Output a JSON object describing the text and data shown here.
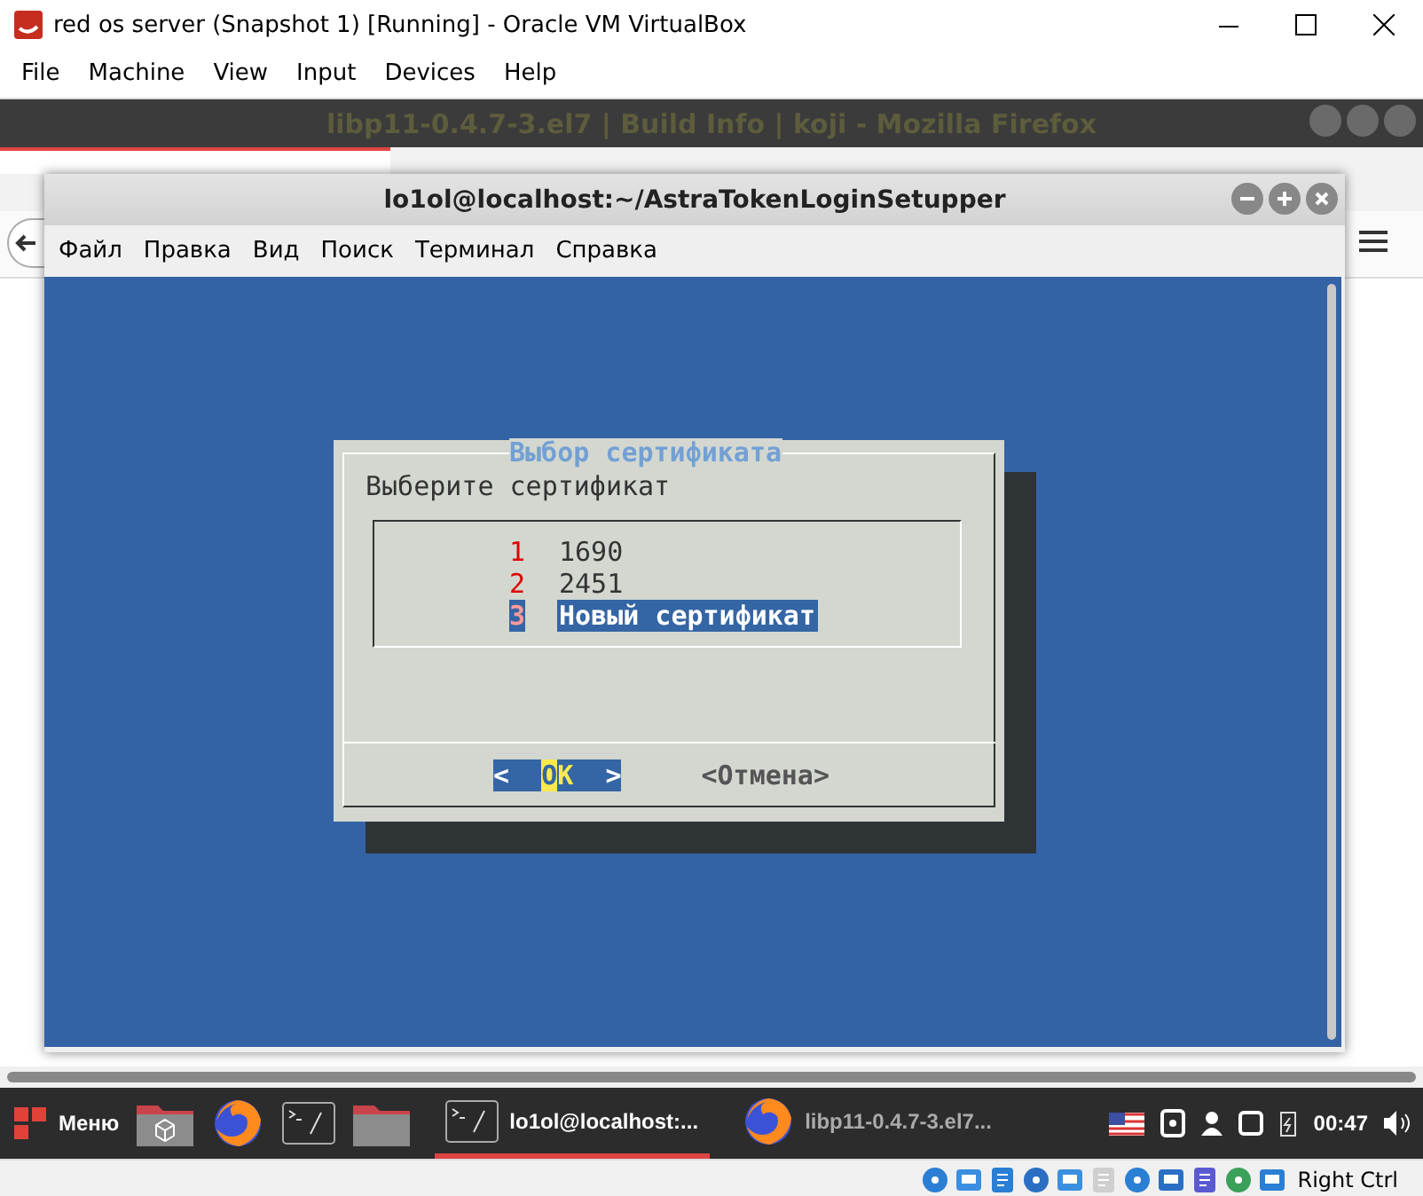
{
  "window": {
    "title": "red os server (Snapshot 1) [Running] - Oracle VM VirtualBox"
  },
  "menu": [
    "File",
    "Machine",
    "View",
    "Input",
    "Devices",
    "Help"
  ],
  "browser": {
    "title": "libp11-0.4.7-3.el7 | Build Info | koji - Mozilla Firefox"
  },
  "terminal": {
    "title": "lo1ol@localhost:~/AstraTokenLoginSetupper",
    "menu": [
      "Файл",
      "Правка",
      "Вид",
      "Поиск",
      "Терминал",
      "Справка"
    ]
  },
  "dialog": {
    "title": "Выбор сертификата",
    "prompt": "Выберите сертификат",
    "items": [
      {
        "key": "1",
        "label": "1690",
        "selected": false
      },
      {
        "key": "2",
        "label": "2451",
        "selected": false
      },
      {
        "key": "3",
        "label": "Новый сертификат",
        "selected": true
      }
    ],
    "buttons": [
      {
        "open": "<",
        "label": "OK",
        "close": ">",
        "selected": true
      },
      {
        "open": "<",
        "label": "Отмена",
        "close": ">",
        "selected": false
      }
    ]
  },
  "taskbar": {
    "menu_label": "Меню",
    "tasks": [
      {
        "kind": "terminal",
        "label": "lo1ol@localhost:...",
        "selected": true
      },
      {
        "kind": "browser",
        "label": "libp11-0.4.7-3.el7...",
        "selected": false
      }
    ],
    "clock": "00:47"
  },
  "status_bar": {
    "host_key": "Right Ctrl"
  }
}
